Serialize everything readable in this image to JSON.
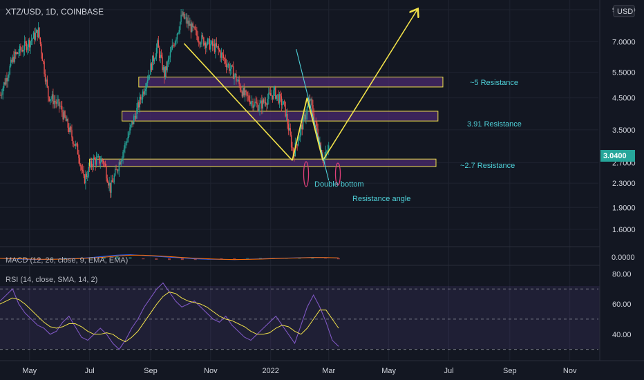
{
  "header": {
    "symbol": "XTZ/USD, 1D, COINBASE",
    "currency_badge": "USD"
  },
  "price_axis": {
    "ticks": [
      "9.0000",
      "7.0000",
      "5.5000",
      "4.5000",
      "3.5000",
      "2.7000",
      "2.3000",
      "1.9000",
      "1.6000"
    ],
    "last_price": "3.0400"
  },
  "macd": {
    "label": "MACD (12, 26, close, 9, EMA, EMA)",
    "tick": "0.0000"
  },
  "rsi": {
    "label": "RSI (14, close, SMA, 14, 2)",
    "ticks": [
      "80.00",
      "60.00",
      "40.00"
    ]
  },
  "time_axis": {
    "ticks": [
      "May",
      "Jul",
      "Sep",
      "Nov",
      "2022",
      "Mar",
      "May",
      "Jul",
      "Sep",
      "Nov"
    ]
  },
  "annotations": {
    "res5": "~5 Resistance",
    "res391": "3.91 Resistance",
    "res27": "~2.7 Resistance",
    "double_bottom": "Double bottom",
    "resistance_angle": "Resistance angle"
  },
  "colors": {
    "background": "#131722",
    "up": "#26a69a",
    "down": "#ef5350",
    "zone_fill": "#4a2a6e",
    "zone_border": "#f2e24a",
    "arrow": "#f2e24a",
    "trend_cyan": "#4fd1d9",
    "rsi_line": "#7e57c2",
    "rsi_ma": "#f2e24a",
    "macd": "#2962ff",
    "signal": "#ff6d00",
    "last_price_badge": "#26a69a"
  },
  "chart_data": {
    "type": "candlestick",
    "title": "XTZ/USD, 1D, COINBASE",
    "x_range": [
      "2021-04-01",
      "2022-11-30"
    ],
    "y_scale": "log",
    "ylim": [
      1.45,
      9.3
    ],
    "last_price": 3.04,
    "price_path": [
      {
        "date": "2021-04-01",
        "close": 4.6
      },
      {
        "date": "2021-04-15",
        "close": 6.2
      },
      {
        "date": "2021-05-01",
        "close": 7.0
      },
      {
        "date": "2021-05-10",
        "close": 7.6
      },
      {
        "date": "2021-05-20",
        "close": 4.6
      },
      {
        "date": "2021-06-01",
        "close": 4.2
      },
      {
        "date": "2021-06-20",
        "close": 2.9
      },
      {
        "date": "2021-06-25",
        "close": 2.35
      },
      {
        "date": "2021-07-05",
        "close": 2.75
      },
      {
        "date": "2021-07-15",
        "close": 2.75
      },
      {
        "date": "2021-07-22",
        "close": 2.2
      },
      {
        "date": "2021-08-10",
        "close": 3.4
      },
      {
        "date": "2021-08-25",
        "close": 4.8
      },
      {
        "date": "2021-09-08",
        "close": 6.8
      },
      {
        "date": "2021-09-15",
        "close": 5.4
      },
      {
        "date": "2021-10-03",
        "close": 8.6
      },
      {
        "date": "2021-10-20",
        "close": 7.2
      },
      {
        "date": "2021-11-08",
        "close": 6.6
      },
      {
        "date": "2021-11-25",
        "close": 5.4
      },
      {
        "date": "2021-12-05",
        "close": 4.6
      },
      {
        "date": "2021-12-20",
        "close": 4.2
      },
      {
        "date": "2022-01-05",
        "close": 4.7
      },
      {
        "date": "2022-01-15",
        "close": 4.2
      },
      {
        "date": "2022-01-24",
        "close": 2.9
      },
      {
        "date": "2022-02-10",
        "close": 4.45
      },
      {
        "date": "2022-02-24",
        "close": 2.75
      },
      {
        "date": "2022-03-01",
        "close": 3.04
      }
    ],
    "zones": [
      {
        "label": "~5 Resistance",
        "low": 4.9,
        "high": 5.3,
        "from": "2021-08-20",
        "to": "2022-06-25"
      },
      {
        "label": "3.91 Resistance",
        "low": 3.75,
        "high": 4.05,
        "from": "2021-08-03",
        "to": "2022-06-20"
      },
      {
        "label": "~2.7 Resistance",
        "low": 2.62,
        "high": 2.78,
        "from": "2021-07-01",
        "to": "2022-06-18"
      }
    ],
    "lines": [
      {
        "name": "trend",
        "points": [
          {
            "date": "2021-10-05",
            "y": 6.9
          },
          {
            "date": "2022-01-23",
            "y": 2.75
          }
        ]
      },
      {
        "name": "arrow",
        "points": [
          {
            "date": "2022-02-23",
            "y": 2.75
          },
          {
            "date": "2022-05-30",
            "y": 9.0
          }
        ]
      },
      {
        "name": "resistance_angle",
        "points": [
          {
            "date": "2022-01-27",
            "y": 6.6
          },
          {
            "date": "2022-03-01",
            "y": 2.35
          }
        ]
      },
      {
        "name": "w_pattern",
        "points": [
          {
            "date": "2022-01-23",
            "y": 2.75
          },
          {
            "date": "2022-02-07",
            "y": 4.5
          },
          {
            "date": "2022-02-23",
            "y": 2.75
          }
        ]
      }
    ],
    "rsi": {
      "ylim": [
        28,
        82
      ],
      "levels": [
        70,
        50,
        30
      ],
      "values": [
        62,
        66,
        70,
        60,
        54,
        50,
        46,
        44,
        40,
        42,
        48,
        52,
        45,
        38,
        36,
        40,
        44,
        40,
        34,
        30,
        36,
        44,
        50,
        58,
        64,
        70,
        74,
        68,
        62,
        58,
        60,
        62,
        58,
        54,
        50,
        48,
        52,
        46,
        42,
        38,
        36,
        40,
        44,
        48,
        52,
        46,
        40,
        34,
        46,
        58,
        66,
        58,
        48,
        36,
        32
      ],
      "ma": [
        60,
        62,
        64,
        63,
        60,
        56,
        52,
        48,
        45,
        44,
        45,
        47,
        47,
        45,
        42,
        40,
        40,
        41,
        40,
        37,
        35,
        38,
        42,
        48,
        54,
        60,
        65,
        68,
        67,
        64,
        62,
        61,
        60,
        58,
        55,
        52,
        50,
        49,
        47,
        45,
        42,
        40,
        40,
        41,
        44,
        46,
        45,
        42,
        40,
        44,
        50,
        56,
        56,
        50,
        44
      ]
    },
    "macd": {
      "values": [
        0.0,
        -0.05,
        -0.1,
        -0.15,
        -0.1,
        -0.04,
        0.0,
        0.1,
        0.25,
        0.4,
        0.45,
        0.35,
        0.25,
        0.15,
        0.05,
        -0.05,
        -0.1,
        -0.12,
        -0.15,
        -0.1,
        -0.05,
        0.0,
        0.04,
        0.08,
        0.12,
        0.1,
        0.04
      ],
      "signal": [
        0.0,
        -0.02,
        -0.06,
        -0.1,
        -0.11,
        -0.08,
        -0.03,
        0.04,
        0.15,
        0.28,
        0.38,
        0.38,
        0.31,
        0.22,
        0.12,
        0.02,
        -0.05,
        -0.1,
        -0.13,
        -0.12,
        -0.08,
        -0.03,
        0.02,
        0.06,
        0.1,
        0.1,
        0.07
      ]
    }
  }
}
